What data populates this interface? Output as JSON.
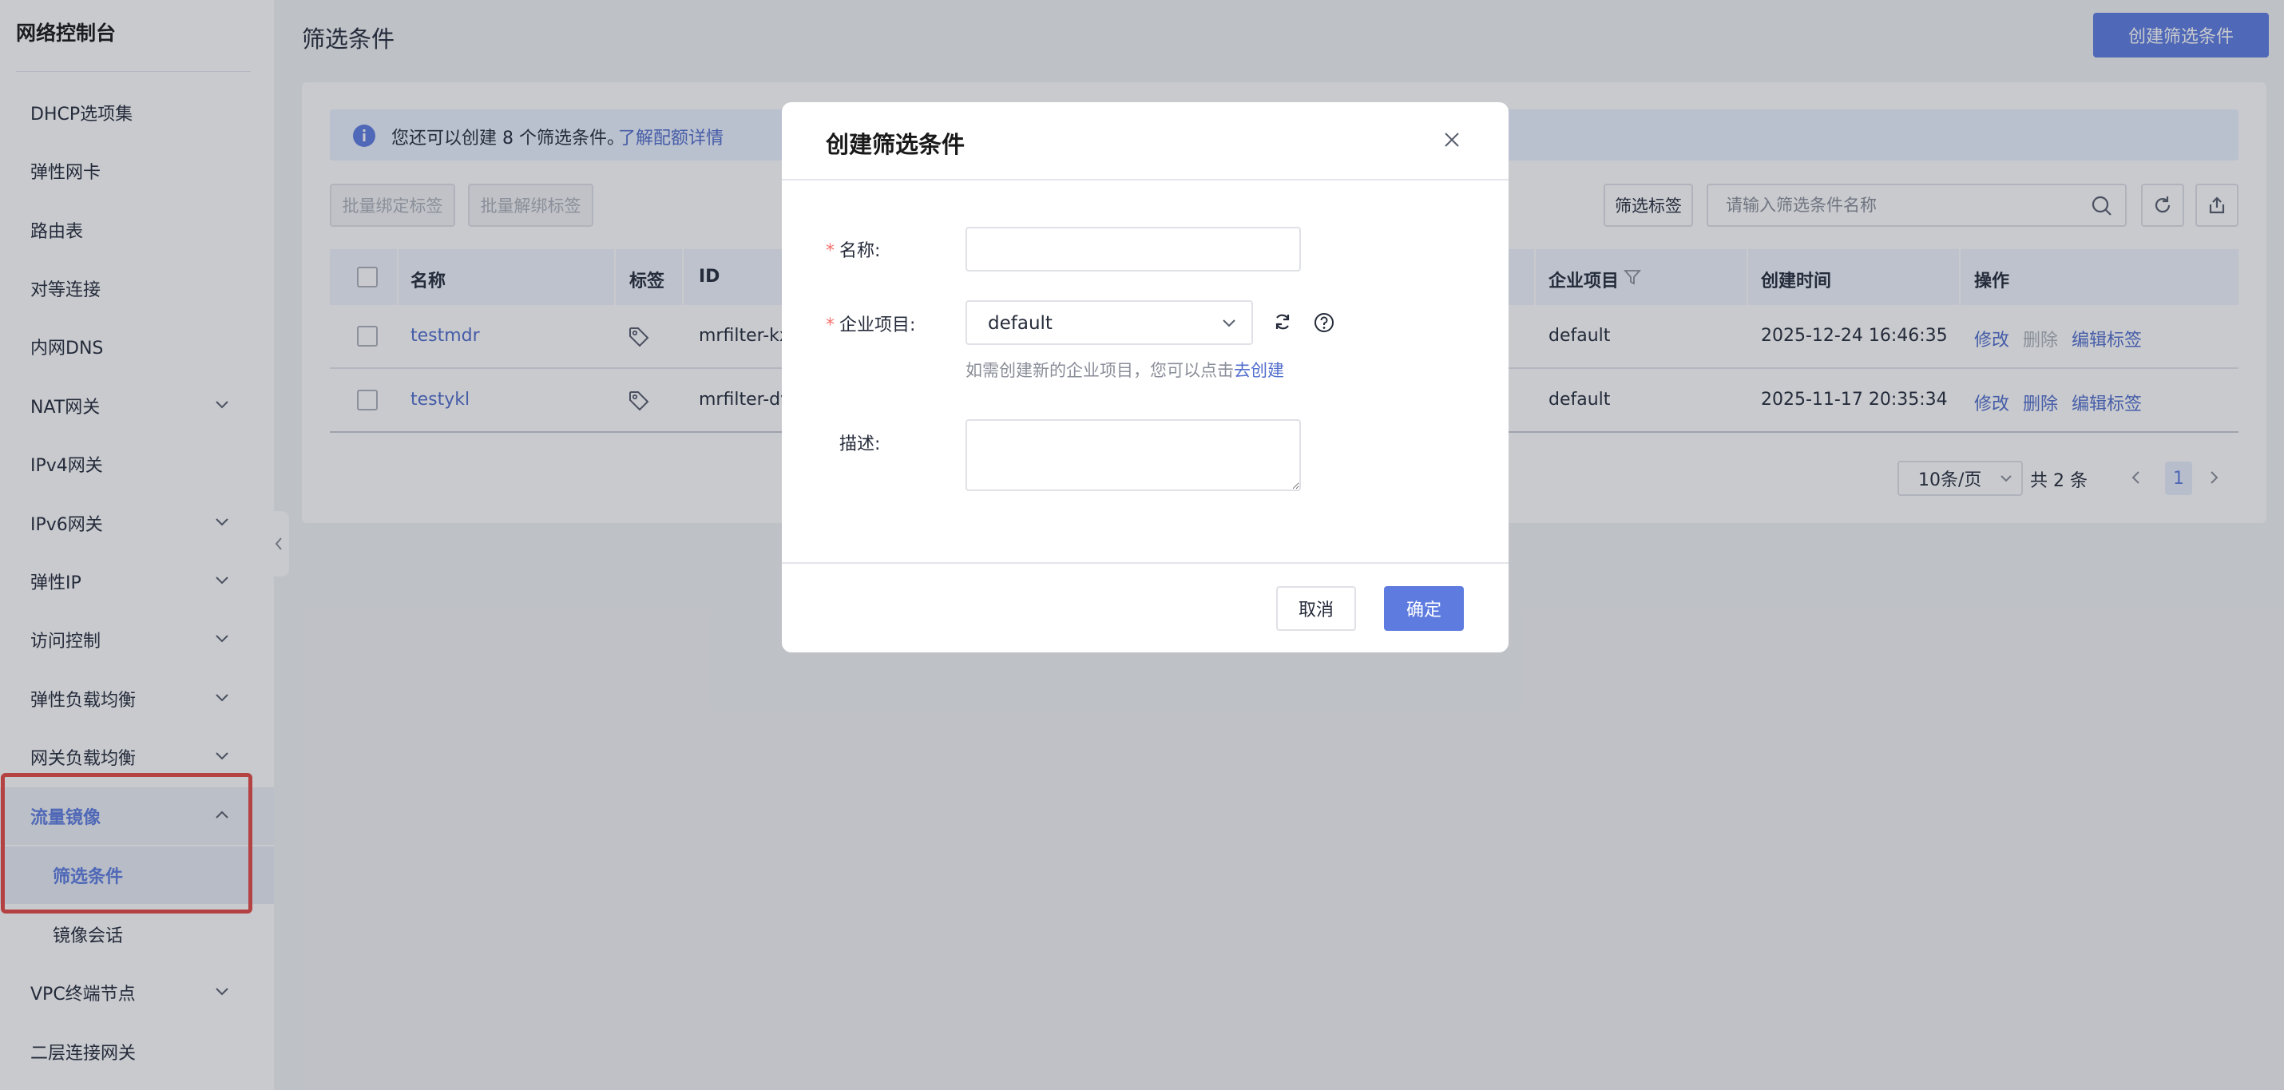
{
  "sidebar": {
    "title": "网络控制台",
    "items": [
      {
        "label": "DHCP选项集"
      },
      {
        "label": "弹性网卡"
      },
      {
        "label": "路由表"
      },
      {
        "label": "对等连接"
      },
      {
        "label": "内网DNS"
      },
      {
        "label": "NAT网关"
      },
      {
        "label": "IPv4网关"
      },
      {
        "label": "IPv6网关"
      },
      {
        "label": "弹性IP"
      },
      {
        "label": "访问控制"
      },
      {
        "label": "弹性负载均衡"
      },
      {
        "label": "网关负载均衡"
      },
      {
        "label": "流量镜像"
      },
      {
        "label": "筛选条件"
      },
      {
        "label": "镜像会话"
      },
      {
        "label": "VPC终端节点"
      },
      {
        "label": "二层连接网关"
      }
    ]
  },
  "page": {
    "title": "筛选条件",
    "create_button": "创建筛选条件"
  },
  "alert": {
    "text": "您还可以创建 8 个筛选条件。",
    "link": "了解配额详情"
  },
  "toolbar": {
    "batch_bind": "批量绑定标签",
    "batch_unbind": "批量解绑标签",
    "filter_tags": "筛选标签",
    "search_placeholder": "请输入筛选条件名称"
  },
  "table": {
    "headers": {
      "name": "名称",
      "tag": "标签",
      "id": "ID",
      "enterprise": "企业项目",
      "created": "创建时间",
      "ops": "操作"
    },
    "rows": [
      {
        "name": "testmdr",
        "id": "mrfilter-kx",
        "enterprise": "default",
        "created": "2025-12-24 16:46:35",
        "op_edit": "修改",
        "op_delete": "删除",
        "op_tags": "编辑标签"
      },
      {
        "name": "testykl",
        "id": "mrfilter-dv",
        "enterprise": "default",
        "created": "2025-11-17 20:35:34",
        "op_edit": "修改",
        "op_delete": "删除",
        "op_tags": "编辑标签"
      }
    ]
  },
  "pagination": {
    "page_size": "10条/页",
    "total": "共 2 条",
    "current": "1"
  },
  "dialog": {
    "title": "创建筛选条件",
    "name_label": "名称:",
    "enterprise_label": "企业项目:",
    "enterprise_value": "default",
    "hint": "如需创建新的企业项目，您可以点击",
    "hint_link": "去创建",
    "desc_label": "描述:",
    "name_value": "",
    "desc_value": "",
    "cancel": "取消",
    "ok": "确定",
    "required_mark": "*"
  },
  "colors": {
    "accent": "#5e7ce0",
    "link": "#526ecc",
    "highlight": "#e64a44",
    "required": "#f66f6a"
  }
}
